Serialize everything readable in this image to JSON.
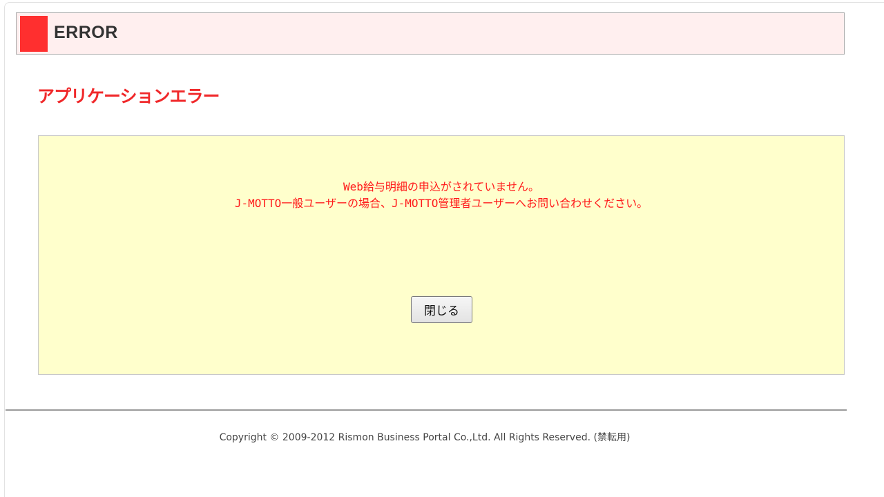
{
  "header": {
    "title": "ERROR"
  },
  "page_title": "アプリケーションエラー",
  "message": {
    "line1": "Web給与明細の申込がされていません。",
    "line2": "J-MOTTO一般ユーザーの場合、J-MOTTO管理者ユーザーへお問い合わせください。"
  },
  "buttons": {
    "close_label": "閉じる"
  },
  "footer": {
    "copyright": "Copyright © 2009-2012 Rismon Business Portal Co.,Ltd. All Rights Reserved. (禁転用)"
  },
  "colors": {
    "accent": "#ff2f2f",
    "header_bg": "#ffefef",
    "error_text": "#ff1a1a",
    "message_bg": "#ffffcc"
  }
}
